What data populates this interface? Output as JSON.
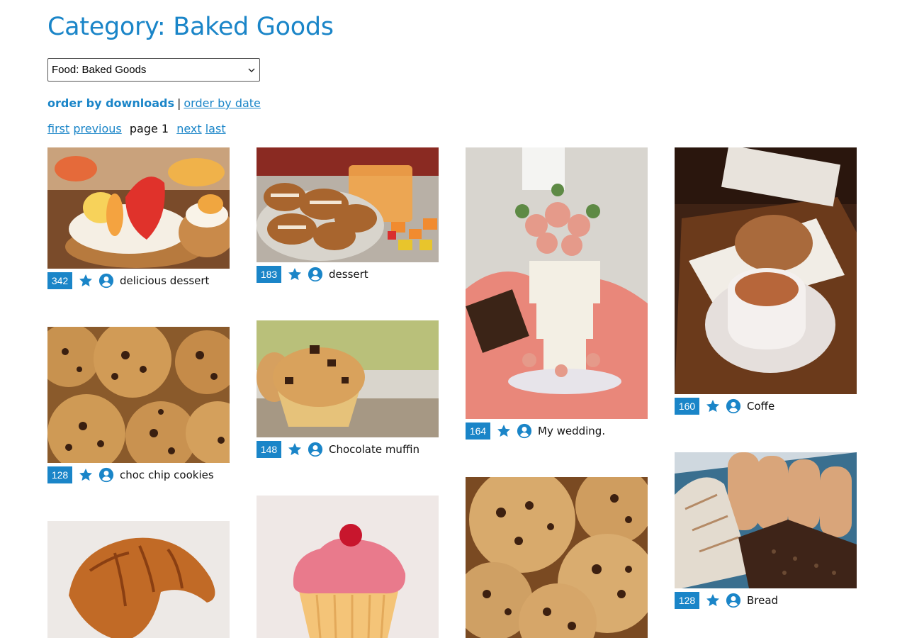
{
  "header": {
    "title": "Category: Baked Goods"
  },
  "category_select": {
    "value": "Food: Baked Goods"
  },
  "ordering": {
    "active": "order by downloads",
    "separator": "|",
    "alternative": "order by date"
  },
  "pager": {
    "first": "first",
    "previous": "previous",
    "page": "page 1",
    "next": "next",
    "last": "last"
  },
  "colors": {
    "accent": "#1a85c8"
  },
  "items": [
    {
      "count": "342",
      "title": "delicious dessert"
    },
    {
      "count": "183",
      "title": "dessert"
    },
    {
      "count": "164",
      "title": "My wedding."
    },
    {
      "count": "160",
      "title": "Coffe"
    },
    {
      "count": "128",
      "title": "choc chip cookies"
    },
    {
      "count": "148",
      "title": "Chocolate muffin"
    },
    {
      "count": "128",
      "title": "Bread"
    }
  ]
}
